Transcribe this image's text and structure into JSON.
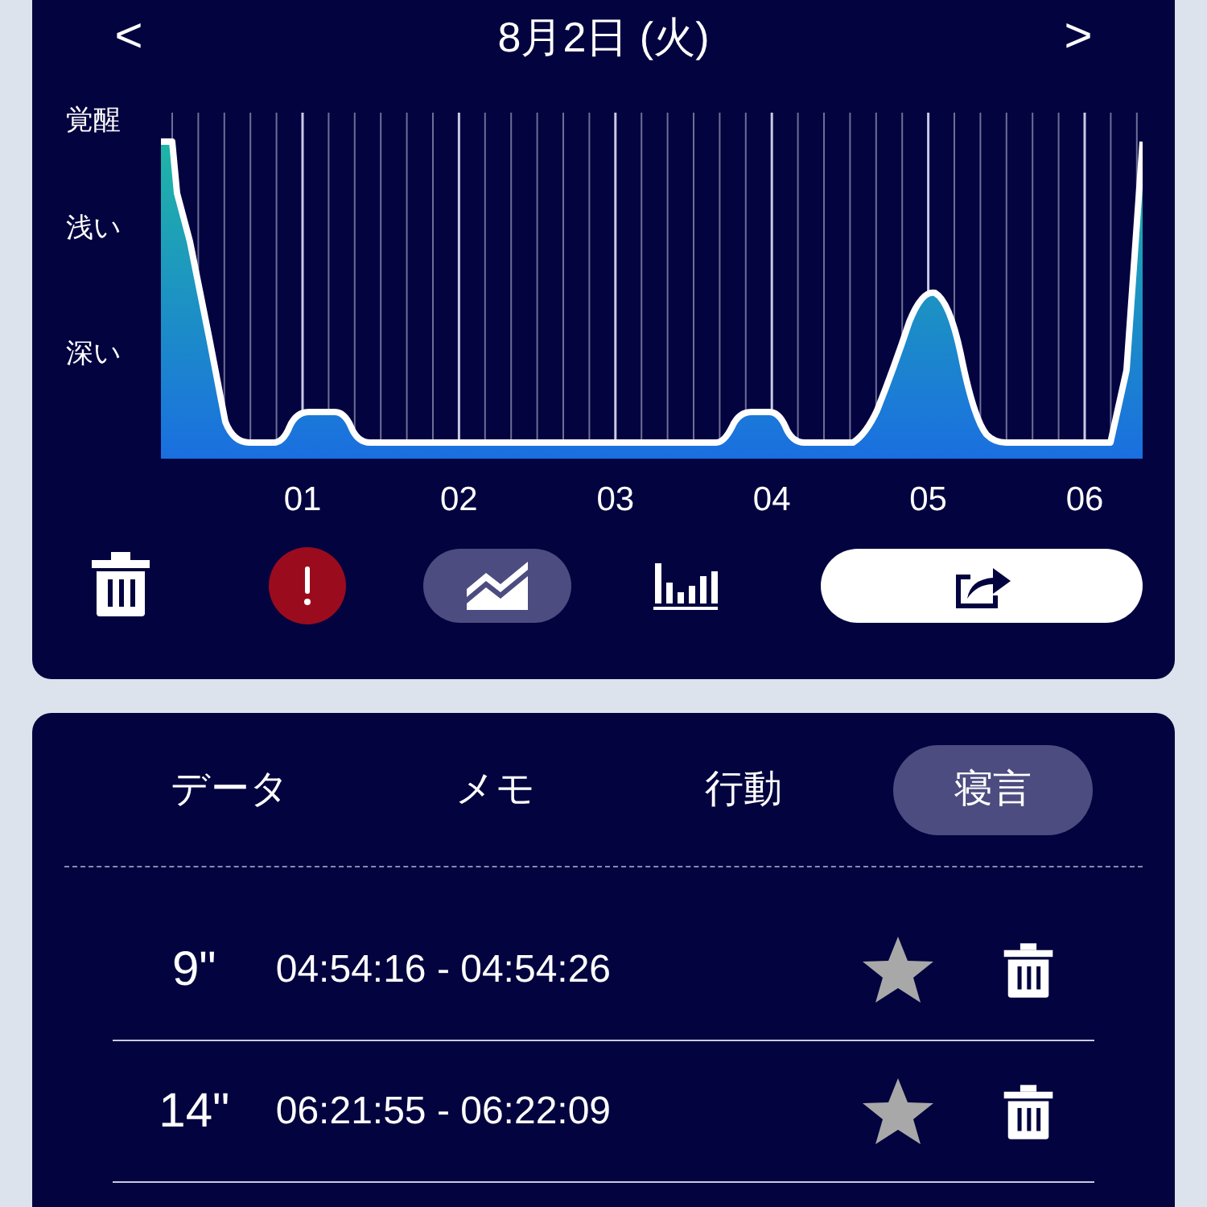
{
  "header": {
    "prev": "<",
    "title": "8月2日 (火)",
    "next": ">"
  },
  "graph": {
    "y_labels": [
      "覚醒",
      "浅い",
      "深い"
    ],
    "x_labels": [
      "01",
      "02",
      "03",
      "04",
      "05",
      "06"
    ]
  },
  "toolbar": {
    "views": [
      {
        "kind": "line",
        "selected": true
      },
      {
        "kind": "bar",
        "selected": false
      }
    ]
  },
  "tabs": [
    {
      "label": "データ",
      "selected": false
    },
    {
      "label": "メモ",
      "selected": false
    },
    {
      "label": "行動",
      "selected": false
    },
    {
      "label": "寝言",
      "selected": true
    }
  ],
  "recordings": [
    {
      "duration": "9\"",
      "time": "04:54:16 - 04:54:26",
      "starred": false
    },
    {
      "duration": "14\"",
      "time": "06:21:55 - 06:22:09",
      "starred": false
    }
  ]
}
